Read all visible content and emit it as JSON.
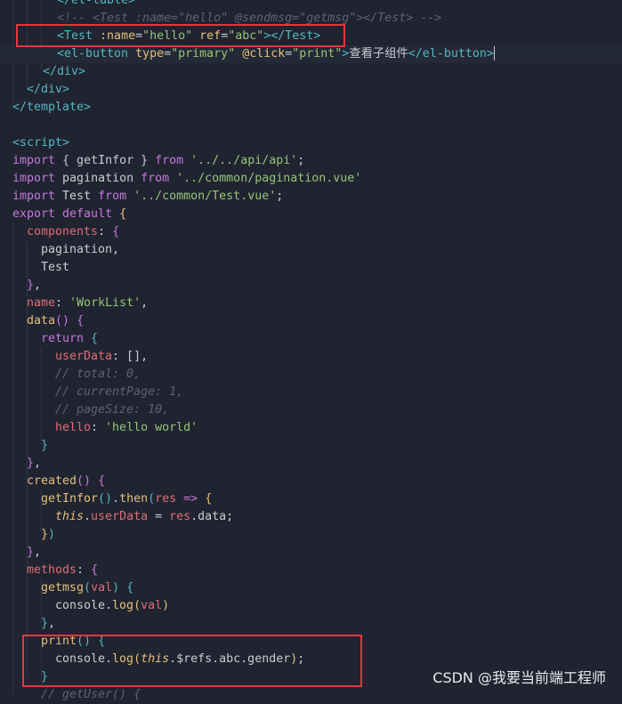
{
  "code_lines": [
    [
      [
        "tag",
        "&lt;/el-table&gt;"
      ]
    ],
    [
      [
        "cm",
        "<!-- <Test :name=\"hello\" @sendmsg=\"getmsg\"></Test> -->"
      ]
    ],
    [
      [
        "tag",
        "<Test "
      ],
      [
        "attr",
        ":name"
      ],
      [
        "pn",
        "="
      ],
      [
        "str",
        "\"hello\""
      ],
      [
        "pn",
        " "
      ],
      [
        "attr",
        "ref"
      ],
      [
        "pn",
        "="
      ],
      [
        "str",
        "\"abc\""
      ],
      [
        "tag",
        "></Test>"
      ]
    ],
    [
      [
        "tag",
        "<el-button "
      ],
      [
        "attr",
        "type"
      ],
      [
        "pn",
        "="
      ],
      [
        "str",
        "\"primary\""
      ],
      [
        "pn",
        " "
      ],
      [
        "attr",
        "@click"
      ],
      [
        "pn",
        "="
      ],
      [
        "str",
        "\"print\""
      ],
      [
        "tag",
        ">"
      ],
      [
        "pn",
        "查看子组件"
      ],
      [
        "tag",
        "</el-button>"
      ]
    ],
    [
      [
        "tag",
        "</div>"
      ]
    ],
    [
      [
        "tag",
        "</div>"
      ]
    ],
    [
      [
        "tag",
        "</template>"
      ]
    ],
    [],
    [
      [
        "tag",
        "<script>"
      ]
    ],
    [
      [
        "kw",
        "import "
      ],
      [
        "pn",
        "{ getInfor } "
      ],
      [
        "kw",
        "from "
      ],
      [
        "str",
        "'../../api/api'"
      ],
      [
        "pn",
        ";"
      ]
    ],
    [
      [
        "kw",
        "import "
      ],
      [
        "pn",
        "pagination "
      ],
      [
        "kw",
        "from "
      ],
      [
        "str",
        "'../common/pagination.vue'"
      ]
    ],
    [
      [
        "kw",
        "import "
      ],
      [
        "pn",
        "Test "
      ],
      [
        "kw",
        "from "
      ],
      [
        "str",
        "'../common/Test.vue'"
      ],
      [
        "pn",
        ";"
      ]
    ],
    [
      [
        "kw",
        "export default "
      ],
      [
        "br1",
        "{"
      ]
    ],
    [
      [
        "prop",
        "components"
      ],
      [
        "pn",
        ": "
      ],
      [
        "br2",
        "{"
      ]
    ],
    [
      [
        "pn",
        "pagination,"
      ]
    ],
    [
      [
        "pn",
        "Test"
      ]
    ],
    [
      [
        "br2",
        "}"
      ],
      [
        "pn",
        ","
      ]
    ],
    [
      [
        "prop",
        "name"
      ],
      [
        "pn",
        ": "
      ],
      [
        "str",
        "'WorkList'"
      ],
      [
        "pn",
        ","
      ]
    ],
    [
      [
        "fn",
        "data"
      ],
      [
        "br2",
        "()"
      ],
      [
        "pn",
        " "
      ],
      [
        "br2",
        "{"
      ]
    ],
    [
      [
        "kw",
        "return "
      ],
      [
        "br3",
        "{"
      ]
    ],
    [
      [
        "prop",
        "userData"
      ],
      [
        "pn",
        ": [],"
      ]
    ],
    [
      [
        "cm",
        "// total: 0,"
      ]
    ],
    [
      [
        "cm",
        "// currentPage: 1,"
      ]
    ],
    [
      [
        "cm",
        "// pageSize: 10,"
      ]
    ],
    [
      [
        "prop",
        "hello"
      ],
      [
        "pn",
        ": "
      ],
      [
        "str",
        "'hello world'"
      ]
    ],
    [
      [
        "br3",
        "}"
      ]
    ],
    [
      [
        "br2",
        "}"
      ],
      [
        "pn",
        ","
      ]
    ],
    [
      [
        "fn",
        "created"
      ],
      [
        "br2",
        "()"
      ],
      [
        "pn",
        " "
      ],
      [
        "br2",
        "{"
      ]
    ],
    [
      [
        "fn",
        "getInfor"
      ],
      [
        "br3",
        "()"
      ],
      [
        "pn",
        "."
      ],
      [
        "fn",
        "then"
      ],
      [
        "br3",
        "("
      ],
      [
        "prop",
        "res"
      ],
      [
        "pn",
        " "
      ],
      [
        "kw",
        "=>"
      ],
      [
        "pn",
        " "
      ],
      [
        "br1",
        "{"
      ]
    ],
    [
      [
        "this",
        "this"
      ],
      [
        "pn",
        "."
      ],
      [
        "prop",
        "userData"
      ],
      [
        "pn",
        " = "
      ],
      [
        "prop",
        "res"
      ],
      [
        "pn",
        ".data;"
      ]
    ],
    [
      [
        "br1",
        "}"
      ],
      [
        "br3",
        ")"
      ]
    ],
    [
      [
        "br2",
        "}"
      ],
      [
        "pn",
        ","
      ]
    ],
    [
      [
        "prop",
        "methods"
      ],
      [
        "pn",
        ": "
      ],
      [
        "br2",
        "{"
      ]
    ],
    [
      [
        "fn",
        "getmsg"
      ],
      [
        "br3",
        "("
      ],
      [
        "prop",
        "val"
      ],
      [
        "br3",
        ")"
      ],
      [
        "pn",
        " "
      ],
      [
        "br3",
        "{"
      ]
    ],
    [
      [
        "pn",
        "console."
      ],
      [
        "fn",
        "log"
      ],
      [
        "br1",
        "("
      ],
      [
        "prop",
        "val"
      ],
      [
        "br1",
        ")"
      ]
    ],
    [
      [
        "br3",
        "}"
      ],
      [
        "pn",
        ","
      ]
    ],
    [
      [
        "fn",
        "print"
      ],
      [
        "br3",
        "()"
      ],
      [
        "pn",
        " "
      ],
      [
        "br3",
        "{"
      ]
    ],
    [
      [
        "pn",
        "console."
      ],
      [
        "fn",
        "log"
      ],
      [
        "br1",
        "("
      ],
      [
        "this",
        "this"
      ],
      [
        "pn",
        ".$refs.abc.gender"
      ],
      [
        "br1",
        ")"
      ],
      [
        "pn",
        ";"
      ]
    ],
    [
      [
        "br3",
        "}"
      ]
    ],
    [
      [
        "cm",
        "// getUser() {"
      ]
    ]
  ],
  "watermark": "CSDN @我要当前端工程师"
}
